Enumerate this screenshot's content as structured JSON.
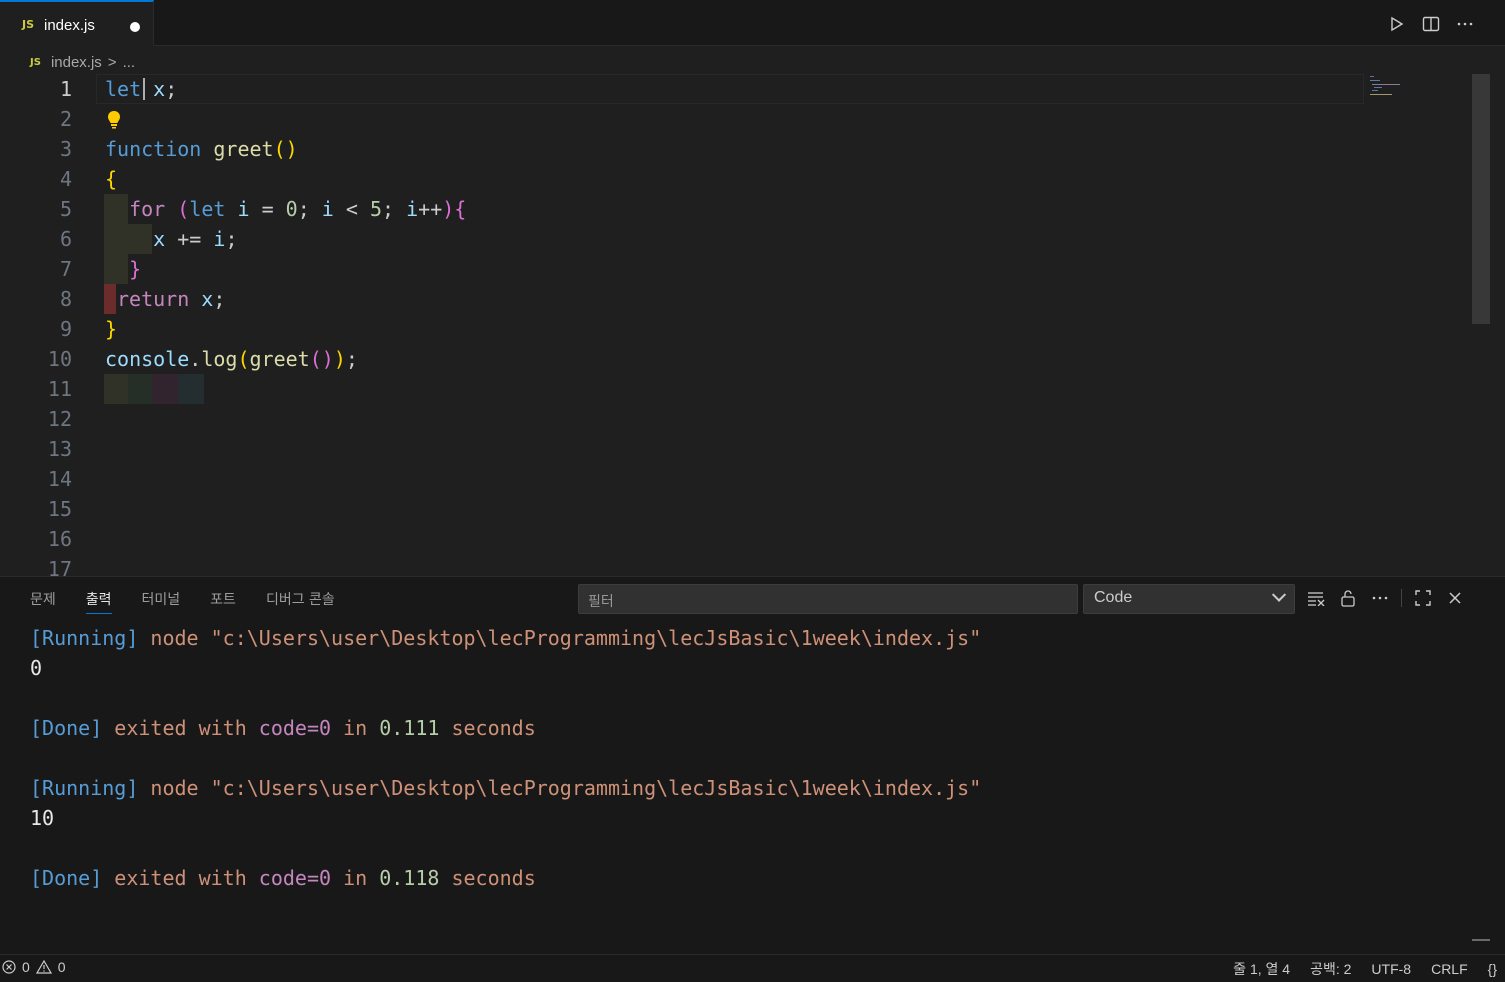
{
  "tab": {
    "lang_badge": "JS",
    "file_name": "index.js"
  },
  "breadcrumb": {
    "lang_badge": "JS",
    "file": "index.js",
    "separator": ">",
    "tail": "..."
  },
  "editor": {
    "line_numbers": [
      "1",
      "2",
      "3",
      "4",
      "5",
      "6",
      "7",
      "8",
      "9",
      "10",
      "11",
      "12",
      "13",
      "14",
      "15",
      "16",
      "17"
    ],
    "active_line": 1
  },
  "panel": {
    "tabs": [
      "문제",
      "출력",
      "터미널",
      "포트",
      "디버그 콘솔"
    ],
    "active_tab": "출력",
    "filter_placeholder": "필터",
    "channel": "Code",
    "output": [
      {
        "tag": "[Running]",
        "text": " node \"c:\\Users\\user\\Desktop\\lecProgramming\\lecJsBasic\\1week\\index.js\""
      },
      {
        "plain": "0"
      },
      {
        "plain": ""
      },
      {
        "done_tag": "[Done]",
        "pre": " exited with ",
        "code": "code=0",
        "mid": " in ",
        "secs": "0.111",
        "post": " seconds"
      },
      {
        "plain": ""
      },
      {
        "tag": "[Running]",
        "text": " node \"c:\\Users\\user\\Desktop\\lecProgramming\\lecJsBasic\\1week\\index.js\""
      },
      {
        "plain": "10"
      },
      {
        "plain": ""
      },
      {
        "done_tag": "[Done]",
        "pre": " exited with ",
        "code": "code=0",
        "mid": " in ",
        "secs": "0.118",
        "post": " seconds"
      }
    ]
  },
  "status": {
    "errors": "0",
    "warnings": "0",
    "cursor": "줄 1, 열 4",
    "spaces": "공백: 2",
    "encoding": "UTF-8",
    "eol": "CRLF",
    "lang_icon": "{}"
  },
  "icons": {
    "run": "play-icon",
    "split": "split-editor-icon",
    "more": "more-icon",
    "clear": "clear-output-icon",
    "lock": "lock-icon",
    "maximize": "maximize-icon",
    "close": "close-icon"
  }
}
